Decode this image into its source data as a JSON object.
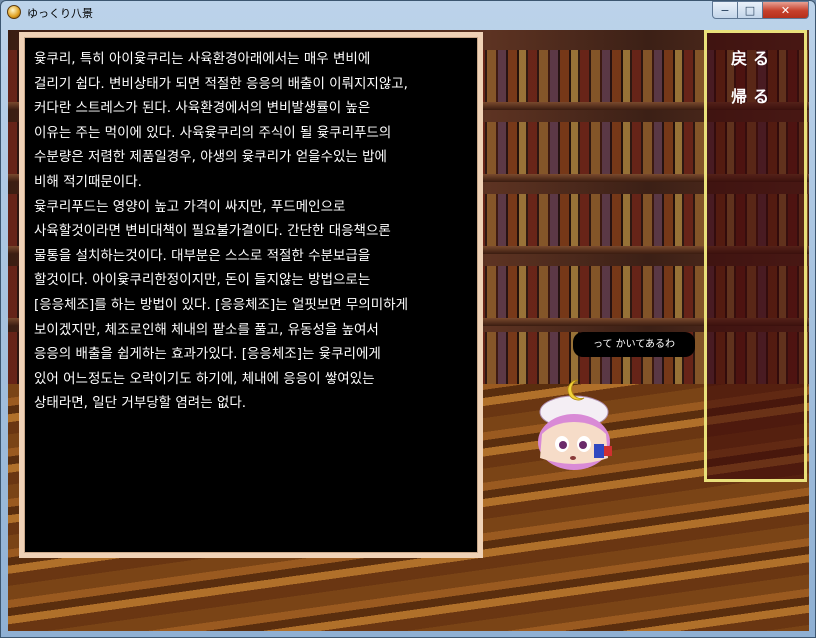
{
  "window": {
    "title": "ゆっくり八景",
    "min_glyph": "−",
    "max_glyph": "□",
    "close_glyph": "✕"
  },
  "textbox": {
    "lines": [
      "윷쿠리, 특히 아이윷쿠리는 사육환경아래에서는 매우 변비에",
      "걸리기 쉽다. 변비상태가 되면 적절한 응응의 배출이 이뤄지지않고,",
      "커다란 스트레스가 된다. 사육환경에서의 변비발생률이 높은",
      "이유는 주는 먹이에 있다. 사육윷쿠리의 주식이 될 윷쿠리푸드의",
      "수분량은 저렴한 제품일경우, 야생의 윷쿠리가 얻을수있는 밥에",
      "비해 적기때문이다.",
      "윷쿠리푸드는 영양이 높고 가격이 싸지만, 푸드메인으로",
      "사육할것이라면 변비대책이 필요불가결이다. 간단한 대응책으론",
      "물통을 설치하는것이다. 대부분은 스스로 적절한 수분보급을",
      "할것이다. 아이윷쿠리한정이지만, 돈이 들지않는 방법으로는",
      "[응응체조]를 하는 방법이 있다. [응응체조]는 얼핏보면 무의미하게",
      "보이겠지만, 체조로인해 체내의 팥소를 풀고, 유동성을 높여서",
      "응응의 배출을 쉽게하는 효과가있다. [응응체조]는 윷쿠리에게",
      "있어 어느정도는 오락이기도 하기에, 체내에 응응이 쌓여있는",
      "상태라면, 일단 거부당할 염려는 없다."
    ]
  },
  "menu": {
    "back_label": "戻る",
    "return_label": "帰る"
  },
  "speech_bubble": {
    "text": "って かいてあるわ"
  },
  "colors": {
    "textbox_border": "#f0d2b6",
    "menu_border": "#e9e07a",
    "menu_bg": "#3c080c"
  }
}
